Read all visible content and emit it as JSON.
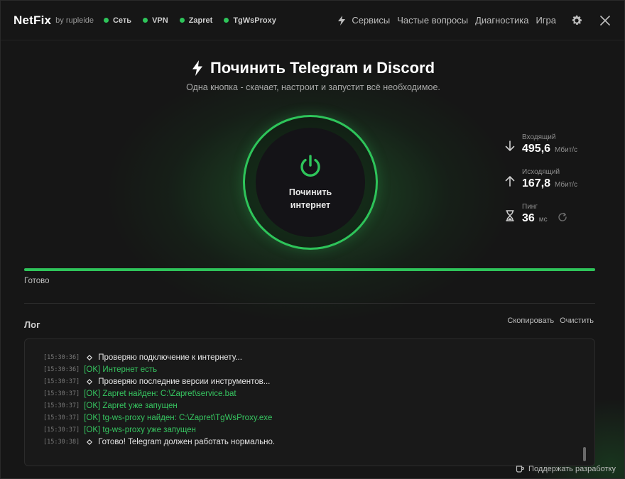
{
  "app": {
    "brand": "NetFix",
    "by": "by rupleide"
  },
  "status": [
    {
      "label": "Сеть",
      "color": "#2ec45a"
    },
    {
      "label": "VPN",
      "color": "#2ec45a"
    },
    {
      "label": "Zapret",
      "color": "#2ec45a"
    },
    {
      "label": "TgWsProxy",
      "color": "#2ec45a"
    }
  ],
  "nav": {
    "services": "Сервисы",
    "faq": "Частые вопросы",
    "diagnostics": "Диагностика",
    "game": "Игра"
  },
  "hero": {
    "title": "Починить Telegram и Discord",
    "subtitle": "Одна кнопка - скачает, настроит и запустит всё необходимое.",
    "button_label": "Починить\nинтернет"
  },
  "stats": {
    "incoming": {
      "label": "Входящий",
      "value": "495,6",
      "unit": "Мбит/с"
    },
    "outgoing": {
      "label": "Исходящий",
      "value": "167,8",
      "unit": "Мбит/с"
    },
    "ping": {
      "label": "Пинг",
      "value": "36",
      "unit": "мс"
    }
  },
  "progress": {
    "percent": 100,
    "text": "Готово"
  },
  "log": {
    "title": "Лог",
    "copy": "Скопировать",
    "clear": "Очистить",
    "lines": [
      {
        "ts": "[15:30:36]",
        "msg": "Проверяю подключение к интернету...",
        "kind": "info"
      },
      {
        "ts": "[15:30:36]",
        "msg": "[OK] Интернет есть",
        "kind": "ok"
      },
      {
        "ts": "[15:30:37]",
        "msg": "Проверяю последние версии инструментов...",
        "kind": "info"
      },
      {
        "ts": "[15:30:37]",
        "msg": "[OK] Zapret найден: C:\\Zapret\\service.bat",
        "kind": "ok"
      },
      {
        "ts": "[15:30:37]",
        "msg": "[OK] Zapret уже запущен",
        "kind": "ok"
      },
      {
        "ts": "[15:30:37]",
        "msg": "[OK] tg-ws-proxy найден: C:\\Zapret\\TgWsProxy.exe",
        "kind": "ok"
      },
      {
        "ts": "[15:30:37]",
        "msg": "[OK] tg-ws-proxy уже запущен",
        "kind": "ok"
      },
      {
        "ts": "[15:30:38]",
        "msg": "Готово! Telegram должен работать нормально.",
        "kind": "info"
      }
    ]
  },
  "footer": {
    "support": "Поддержать разработку"
  },
  "colors": {
    "accent": "#2ec45a",
    "background": "#161616"
  }
}
